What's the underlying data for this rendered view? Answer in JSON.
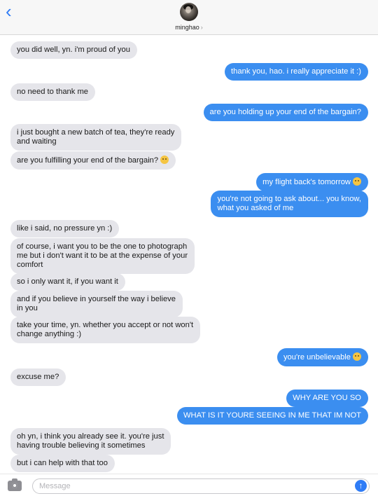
{
  "header": {
    "contact_name": "minghao",
    "name_chevron": "›",
    "back_glyph": "‹"
  },
  "messages": [
    {
      "side": "received",
      "lines": [
        "you did well, yn. i'm proud of you"
      ]
    },
    {
      "side": "sent",
      "lines": [
        "thank you, hao. i really appreciate it :)"
      ]
    },
    {
      "side": "received",
      "lines": [
        "no need to thank me"
      ]
    },
    {
      "side": "sent",
      "lines": [
        "are you holding up your end of the bargain?"
      ]
    },
    {
      "side": "received",
      "lines": [
        "i just bought a new batch of tea, they're ready",
        "and waiting"
      ]
    },
    {
      "side": "received",
      "lines": [
        "are you fulfilling your end of the bargain?"
      ],
      "emoji": "slightly-smiling-emoji"
    },
    {
      "side": "sent",
      "lines": [
        "my flight back's tomorrow"
      ],
      "emoji": "sweat-smile-emoji"
    },
    {
      "side": "sent",
      "lines": [
        "you're not going to ask about... you know,",
        "what you asked of me"
      ]
    },
    {
      "side": "received",
      "lines": [
        "like i said, no pressure yn :)"
      ]
    },
    {
      "side": "received",
      "lines": [
        "of course, i want you to be the one to photograph",
        "me but i don't want it to be at the expense of your",
        "comfort"
      ]
    },
    {
      "side": "received",
      "lines": [
        "so i only want it, if you want it"
      ]
    },
    {
      "side": "received",
      "lines": [
        "and if you believe in yourself the way i believe",
        "in you"
      ]
    },
    {
      "side": "received",
      "lines": [
        "take your time, yn. whether you accept or not won't",
        "change anything :)"
      ]
    },
    {
      "side": "sent",
      "lines": [
        "you're unbelievable"
      ],
      "emoji": "weary-emoji"
    },
    {
      "side": "received",
      "lines": [
        "excuse me?"
      ]
    },
    {
      "side": "sent",
      "lines": [
        "WHY ARE YOU SO"
      ]
    },
    {
      "side": "sent",
      "lines": [
        "WHAT IS IT YOURE SEEING IN ME THAT IM NOT"
      ]
    },
    {
      "side": "received",
      "lines": [
        "oh yn, i think you already see it. you're just",
        "having trouble believing it sometimes"
      ]
    },
    {
      "side": "received",
      "lines": [
        "but i can help with that too"
      ]
    }
  ],
  "composer": {
    "placeholder": "Message",
    "value": "",
    "send_glyph": "↑"
  },
  "colors": {
    "sent_bubble": "#3b8ef0",
    "received_bubble": "#e5e5ea",
    "accent": "#2f7cf6"
  }
}
